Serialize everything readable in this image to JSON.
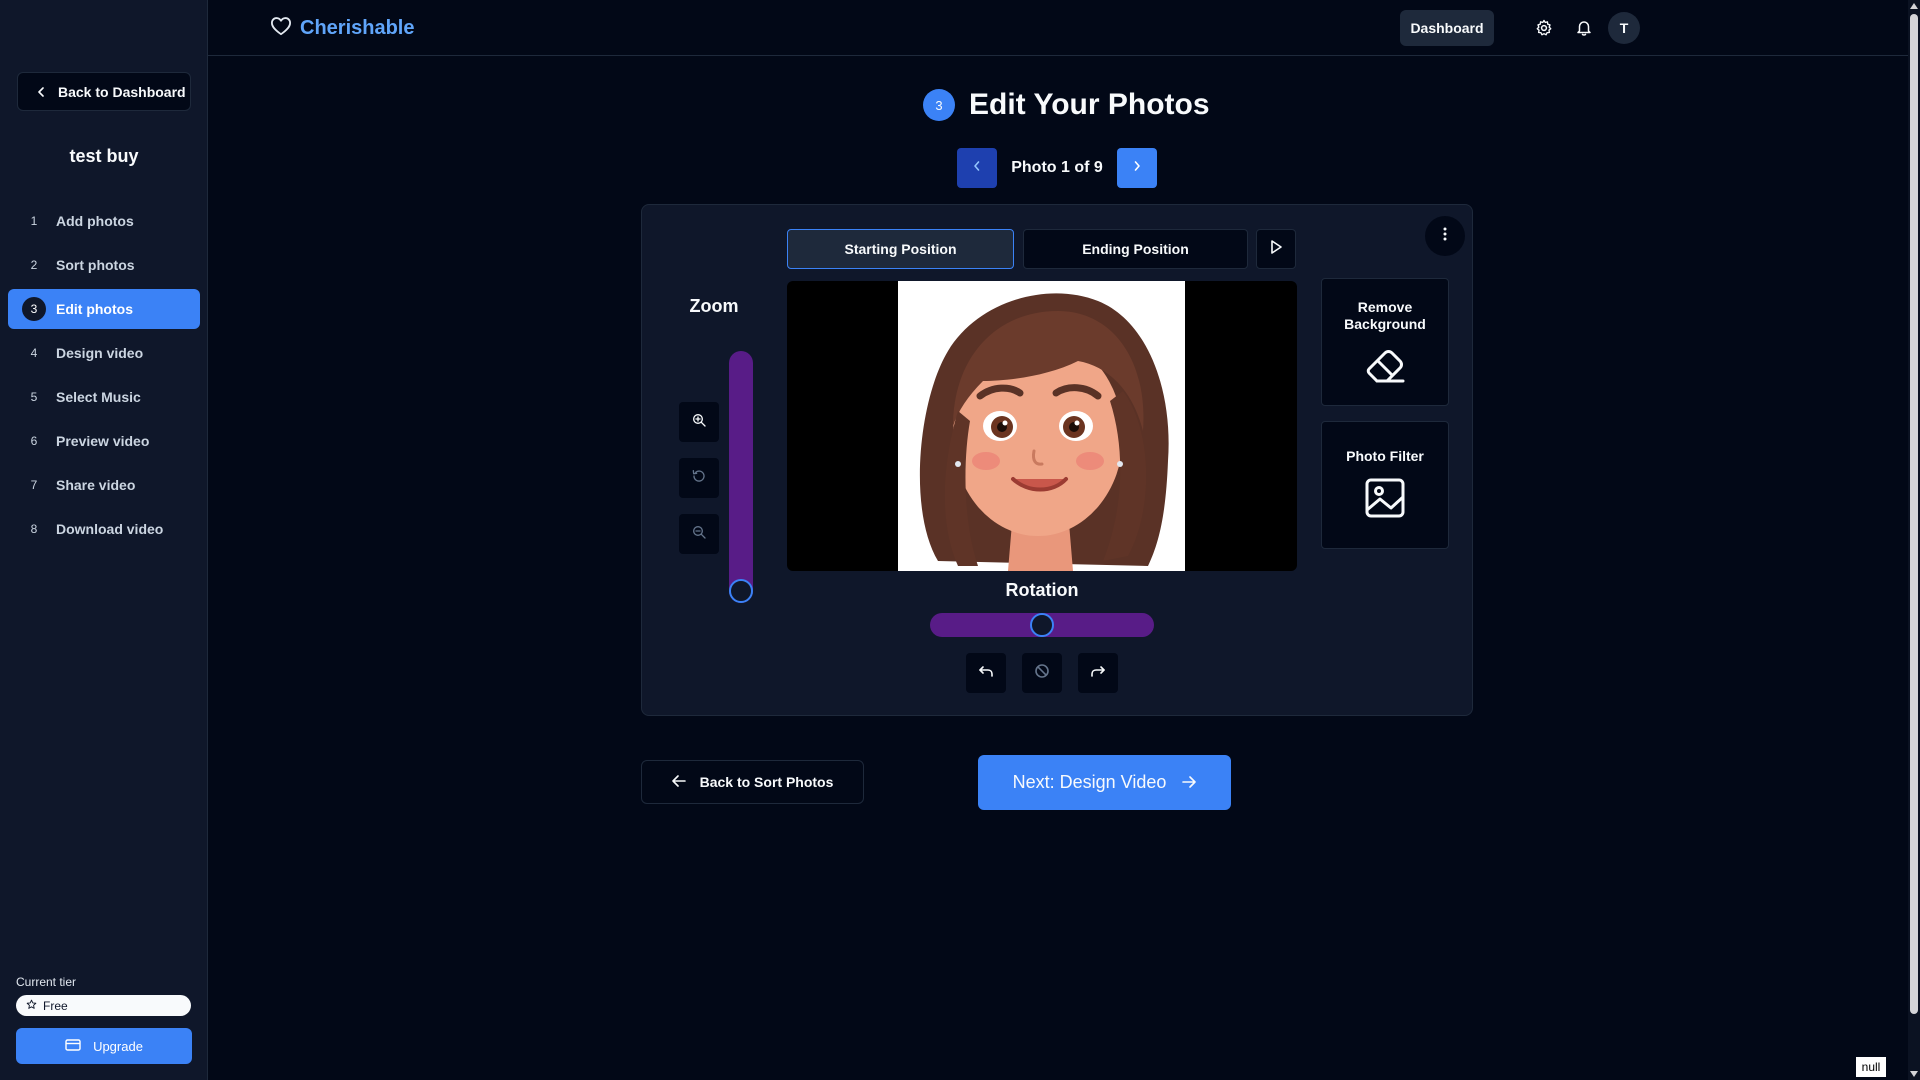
{
  "header": {
    "brand": "Cherishable",
    "dashboard_label": "Dashboard",
    "avatar_initial": "T"
  },
  "sidebar": {
    "back_label": "Back to Dashboard",
    "project_name": "test buy",
    "steps": [
      {
        "num": "1",
        "label": "Add photos"
      },
      {
        "num": "2",
        "label": "Sort photos"
      },
      {
        "num": "3",
        "label": "Edit photos",
        "active": true
      },
      {
        "num": "4",
        "label": "Design video"
      },
      {
        "num": "5",
        "label": "Select Music"
      },
      {
        "num": "6",
        "label": "Preview video"
      },
      {
        "num": "7",
        "label": "Share video"
      },
      {
        "num": "8",
        "label": "Download video"
      }
    ],
    "tier_label": "Current tier",
    "tier_value": "Free",
    "upgrade_label": "Upgrade"
  },
  "main": {
    "step_num": "3",
    "title": "Edit Your Photos",
    "pager_text": "Photo 1 of 9",
    "tabs": {
      "start": "Starting Position",
      "end": "Ending Position"
    },
    "zoom_label": "Zoom",
    "zoom_level": 0,
    "rotation_label": "Rotation",
    "rotation_level": 0.5,
    "remove_bg_label": "Remove Background",
    "photo_filter_label": "Photo Filter",
    "back_sort_label": "Back to Sort Photos",
    "next_label": "Next: Design Video"
  },
  "misc": {
    "null_tag": "null"
  },
  "colors": {
    "accent": "#3b82f6",
    "slider_track": "#581c87",
    "background": "#020817",
    "panel": "#0f172a"
  }
}
